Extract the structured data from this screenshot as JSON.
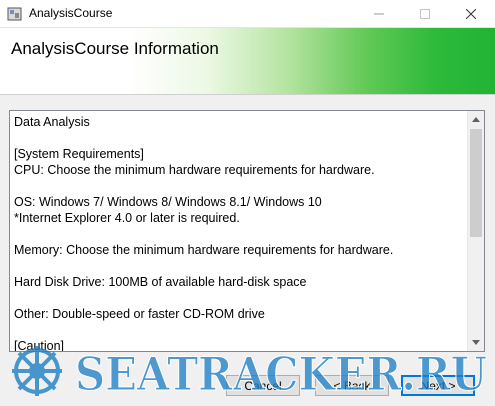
{
  "window": {
    "title": "AnalysisCourse"
  },
  "header": {
    "title": "AnalysisCourse Information"
  },
  "content": {
    "lines": [
      "Data Analysis",
      "",
      "[System Requirements]",
      "CPU: Choose the minimum hardware requirements for hardware.",
      "",
      "OS: Windows 7/ Windows 8/ Windows 8.1/ Windows 10",
      "*Internet Explorer 4.0 or later is required.",
      "",
      "Memory: Choose the minimum hardware requirements for hardware.",
      "",
      "Hard Disk Drive: 100MB of available hard-disk space",
      "",
      "Other: Double-speed or faster CD-ROM drive",
      "",
      "[Caution]"
    ]
  },
  "buttons": {
    "cancel": "Cancel",
    "back": "< Back",
    "next": "Next >"
  },
  "watermark": {
    "text": "SEATRACKER.RU"
  },
  "colors": {
    "header_gradient_end": "#22b335",
    "focus_border": "#0078d7",
    "watermark": "#1f7fc4"
  }
}
